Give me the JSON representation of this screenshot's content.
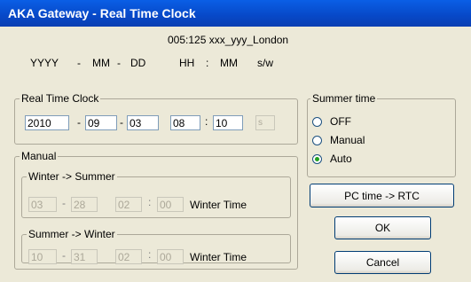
{
  "title": "AKA Gateway - Real Time Clock",
  "device_label": "005:125  xxx_yyy_London",
  "format_header": {
    "yyyy": "YYYY",
    "dash1": "-",
    "mm": "MM",
    "dash2": "-",
    "dd": "DD",
    "hh": "HH",
    "colon": ":",
    "min": "MM",
    "sw": "s/w"
  },
  "rtc": {
    "group_label": "Real Time Clock",
    "year": "2010",
    "month": "09",
    "day": "03",
    "hour": "08",
    "minute": "10",
    "sw": "s",
    "sep_dash": "-",
    "sep_colon": ":"
  },
  "summer_time": {
    "group_label": "Summer time",
    "options": [
      "OFF",
      "Manual",
      "Auto"
    ],
    "selected": "Auto"
  },
  "manual": {
    "group_label": "Manual",
    "winter_to_summer": {
      "label": "Winter -> Summer",
      "month": "03",
      "day": "28",
      "hour": "02",
      "minute": "00",
      "suffix": "Winter Time"
    },
    "summer_to_winter": {
      "label": "Summer -> Winter",
      "month": "10",
      "day": "31",
      "hour": "02",
      "minute": "00",
      "suffix": "Winter Time"
    }
  },
  "buttons": {
    "pc_time": "PC time -> RTC",
    "ok": "OK",
    "cancel": "Cancel"
  }
}
